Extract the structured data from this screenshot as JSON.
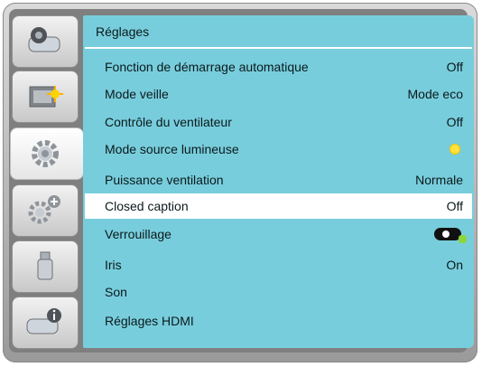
{
  "panel_title": "Réglages",
  "menu": [
    {
      "label": "Fonction de démarrage automatique",
      "value": "Off"
    },
    {
      "label": "Mode veille",
      "value": "Mode eco"
    },
    {
      "label": "Contrôle du ventilateur",
      "value": "Off"
    },
    {
      "label": "Mode source lumineuse",
      "value": ""
    },
    {
      "label": "Puissance ventilation",
      "value": "Normale"
    },
    {
      "label": "Closed caption",
      "value": "Off"
    },
    {
      "label": "Verrouillage",
      "value": ""
    },
    {
      "label": "Iris",
      "value": "On"
    },
    {
      "label": "Son",
      "value": ""
    },
    {
      "label": "Réglages HDMI",
      "value": ""
    }
  ],
  "sidebar": [
    {
      "icon": "projector-icon"
    },
    {
      "icon": "display-settings-icon"
    },
    {
      "icon": "gear-icon"
    },
    {
      "icon": "gear-plus-icon"
    },
    {
      "icon": "usb-icon"
    },
    {
      "icon": "info-icon"
    }
  ],
  "selected_index": 5,
  "colors": {
    "panel": "#78cddc",
    "selected_row": "#ffffff",
    "frame": "#9a9a9a",
    "bulb": "#ffe23b"
  }
}
